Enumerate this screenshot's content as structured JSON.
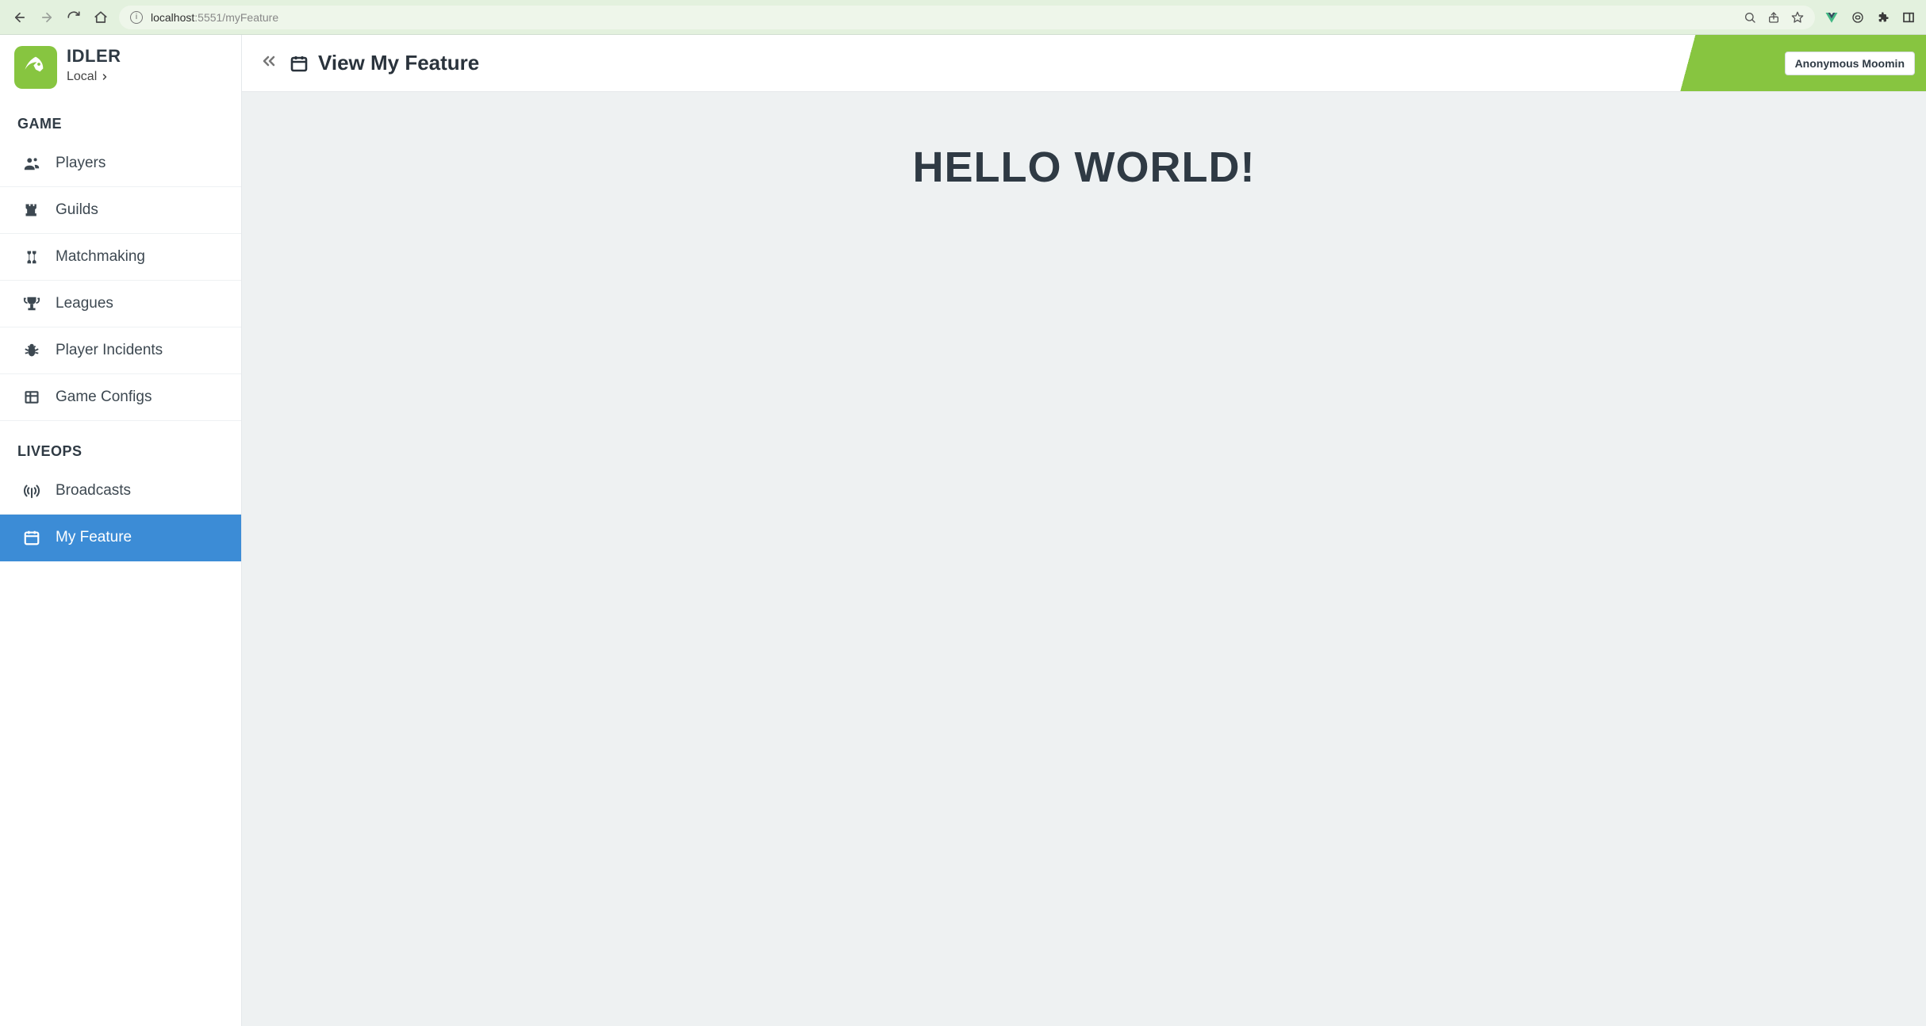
{
  "browser": {
    "url_host": "localhost",
    "url_port_path": ":5551/myFeature"
  },
  "brand": {
    "name": "IDLER",
    "env": "Local"
  },
  "sidebar": {
    "sections": [
      {
        "label": "GAME",
        "items": [
          {
            "label": "Players",
            "icon": "users-icon"
          },
          {
            "label": "Guilds",
            "icon": "rook-icon"
          },
          {
            "label": "Matchmaking",
            "icon": "chess-icon"
          },
          {
            "label": "Leagues",
            "icon": "trophy-icon"
          },
          {
            "label": "Player Incidents",
            "icon": "bug-icon"
          },
          {
            "label": "Game Configs",
            "icon": "table-icon"
          }
        ]
      },
      {
        "label": "LIVEOPS",
        "items": [
          {
            "label": "Broadcasts",
            "icon": "antenna-icon"
          },
          {
            "label": "My Feature",
            "icon": "calendar-icon",
            "active": true
          }
        ]
      }
    ]
  },
  "header": {
    "title": "View My Feature",
    "user": "Anonymous Moomin"
  },
  "main": {
    "hello": "HELLO WORLD!"
  }
}
